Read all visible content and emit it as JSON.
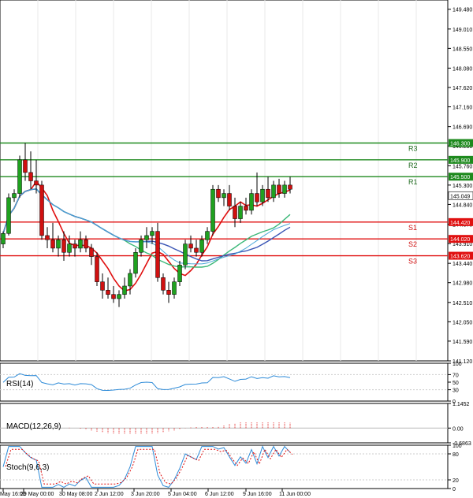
{
  "chart_data": {
    "type": "candlestick",
    "price_panel": {
      "y_range": [
        141.12,
        149.7
      ],
      "price_ticks": [
        "149.480",
        "149.010",
        "148.550",
        "148.080",
        "147.620",
        "147.160",
        "146.690",
        "146.230",
        "145.760",
        "145.300",
        "144.840",
        "144.370",
        "143.910",
        "143.440",
        "142.980",
        "142.510",
        "142.050",
        "141.590",
        "141.120"
      ],
      "levels": [
        {
          "name": "R3",
          "value": 146.3,
          "tag": "146.300",
          "color": "#1e8a1e"
        },
        {
          "name": "R2",
          "value": 145.9,
          "tag": "145.900",
          "color": "#1e8a1e"
        },
        {
          "name": "R1",
          "value": 145.5,
          "tag": "145.500",
          "color": "#1e8a1e"
        },
        {
          "name": "S1",
          "value": 144.42,
          "tag": "144.420",
          "color": "#e01010"
        },
        {
          "name": "S2",
          "value": 144.02,
          "tag": "144.020",
          "color": "#e01010"
        },
        {
          "name": "S3",
          "value": 143.62,
          "tag": "143.620",
          "color": "#e01010"
        }
      ],
      "current_price": {
        "value": 145.049,
        "tag": "145.049"
      },
      "candles": [
        [
          143.9,
          144.2,
          143.8,
          144.15
        ],
        [
          144.15,
          145.1,
          144.1,
          145.0
        ],
        [
          145.0,
          145.2,
          144.9,
          145.1
        ],
        [
          145.1,
          146.0,
          145.0,
          145.9
        ],
        [
          145.9,
          146.3,
          145.4,
          145.6
        ],
        [
          145.6,
          146.1,
          145.2,
          145.4
        ],
        [
          145.4,
          145.9,
          145.1,
          145.3
        ],
        [
          145.3,
          145.4,
          144.0,
          144.1
        ],
        [
          144.1,
          144.3,
          143.8,
          144.0
        ],
        [
          144.0,
          144.4,
          143.7,
          143.8
        ],
        [
          143.8,
          144.1,
          143.6,
          144.0
        ],
        [
          144.0,
          144.2,
          143.5,
          143.7
        ],
        [
          143.7,
          144.1,
          143.6,
          143.9
        ],
        [
          143.9,
          144.0,
          143.6,
          143.8
        ],
        [
          143.8,
          144.2,
          143.7,
          144.0
        ],
        [
          144.0,
          144.1,
          143.7,
          143.8
        ],
        [
          143.8,
          143.9,
          143.4,
          143.6
        ],
        [
          143.6,
          143.7,
          142.9,
          143.0
        ],
        [
          143.0,
          143.2,
          142.6,
          142.8
        ],
        [
          142.8,
          143.1,
          142.6,
          142.7
        ],
        [
          142.7,
          142.9,
          142.5,
          142.6
        ],
        [
          142.6,
          142.8,
          142.4,
          142.7
        ],
        [
          142.7,
          143.1,
          142.6,
          142.9
        ],
        [
          142.9,
          143.3,
          142.7,
          143.2
        ],
        [
          143.2,
          143.8,
          143.1,
          143.7
        ],
        [
          143.7,
          144.1,
          143.6,
          144.0
        ],
        [
          144.0,
          144.3,
          143.8,
          144.1
        ],
        [
          144.1,
          144.3,
          143.9,
          144.2
        ],
        [
          144.2,
          144.4,
          143.0,
          143.1
        ],
        [
          143.1,
          143.2,
          142.7,
          142.8
        ],
        [
          142.8,
          143.0,
          142.5,
          142.7
        ],
        [
          142.7,
          143.1,
          142.6,
          143.0
        ],
        [
          143.0,
          143.5,
          142.9,
          143.4
        ],
        [
          143.4,
          144.0,
          143.3,
          143.9
        ],
        [
          143.9,
          144.1,
          143.7,
          143.8
        ],
        [
          143.8,
          144.0,
          143.6,
          143.7
        ],
        [
          143.7,
          144.1,
          143.6,
          144.0
        ],
        [
          144.0,
          144.3,
          143.9,
          144.2
        ],
        [
          144.2,
          145.3,
          144.1,
          145.2
        ],
        [
          145.2,
          145.3,
          144.9,
          145.0
        ],
        [
          145.0,
          145.2,
          144.8,
          145.1
        ],
        [
          145.1,
          145.3,
          144.7,
          144.8
        ],
        [
          144.8,
          145.0,
          144.3,
          144.5
        ],
        [
          144.5,
          144.9,
          144.4,
          144.8
        ],
        [
          144.8,
          145.0,
          144.6,
          144.7
        ],
        [
          144.7,
          145.2,
          144.6,
          145.1
        ],
        [
          145.1,
          145.6,
          144.8,
          144.9
        ],
        [
          144.9,
          145.3,
          144.8,
          145.2
        ],
        [
          145.2,
          145.5,
          144.9,
          145.0
        ],
        [
          145.0,
          145.4,
          144.9,
          145.3
        ],
        [
          145.3,
          145.45,
          145.0,
          145.1
        ],
        [
          145.1,
          145.4,
          145.0,
          145.3
        ],
        [
          145.3,
          145.5,
          145.1,
          145.2
        ]
      ]
    },
    "x_axis": {
      "labels": [
        "May 16:00",
        "29 May 00:00",
        "30 May 08:00",
        "2 Jun 12:00",
        "3 Jun 20:00",
        "5 Jun 04:00",
        "6 Jun 12:00",
        "9 Jun 16:00",
        "11 Jun 00:00"
      ]
    },
    "rsi_panel": {
      "name": "RSI(14)",
      "ticks": [
        "100",
        "70",
        "50",
        "30",
        "0"
      ]
    },
    "macd_panel": {
      "name": "MACD(12,26,9)",
      "ticks": [
        "1.1452",
        "0.00",
        "-0.6863"
      ]
    },
    "stoch_panel": {
      "name": "Stoch(9,6,3)",
      "ticks": [
        "100",
        "80",
        "20",
        "0"
      ]
    }
  }
}
